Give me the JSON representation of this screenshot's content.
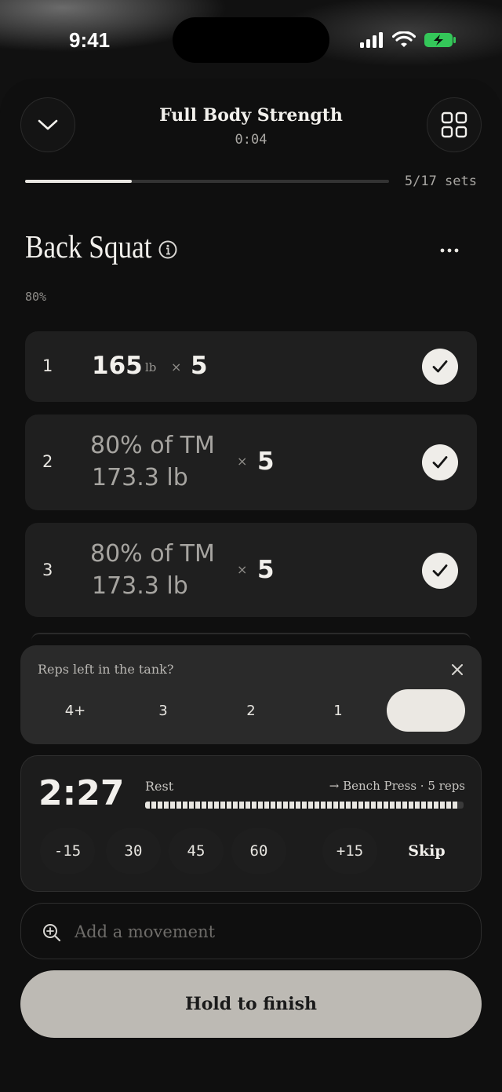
{
  "status_bar": {
    "time": "9:41"
  },
  "header": {
    "title": "Full Body Strength",
    "elapsed": "0:04",
    "progress_fraction": 0.294,
    "sets_count": "5/17 sets"
  },
  "exercise": {
    "name": "Back Squat",
    "intensity": "80%"
  },
  "sets": [
    {
      "number": "1",
      "weight": "165",
      "unit": "lb",
      "times": "×",
      "reps": "5",
      "completed": true
    },
    {
      "number": "2",
      "percent_label": "80% of TM",
      "weight_label": "173.3 lb",
      "times": "×",
      "reps": "5",
      "completed": true
    },
    {
      "number": "3",
      "percent_label": "80% of TM",
      "weight_label": "173.3 lb",
      "times": "×",
      "reps": "5",
      "completed": true
    }
  ],
  "rir_prompt": {
    "label": "Reps left in the tank?",
    "options": [
      "4+",
      "3",
      "2",
      "1",
      ""
    ],
    "selected_index": 4
  },
  "rest_timer": {
    "time": "2:27",
    "label": "Rest",
    "next": "→ Bench Press · 5 reps",
    "remaining_fraction": 0.98,
    "adjust": [
      "-15",
      "30",
      "45",
      "60",
      "+15"
    ],
    "skip_label": "Skip"
  },
  "add_movement": {
    "placeholder": "Add a movement"
  },
  "finish": {
    "label": "Hold to finish"
  },
  "colors": {
    "accent": "#e8e6e1",
    "battery": "#34c759",
    "finish_button": "#bdbab4"
  }
}
